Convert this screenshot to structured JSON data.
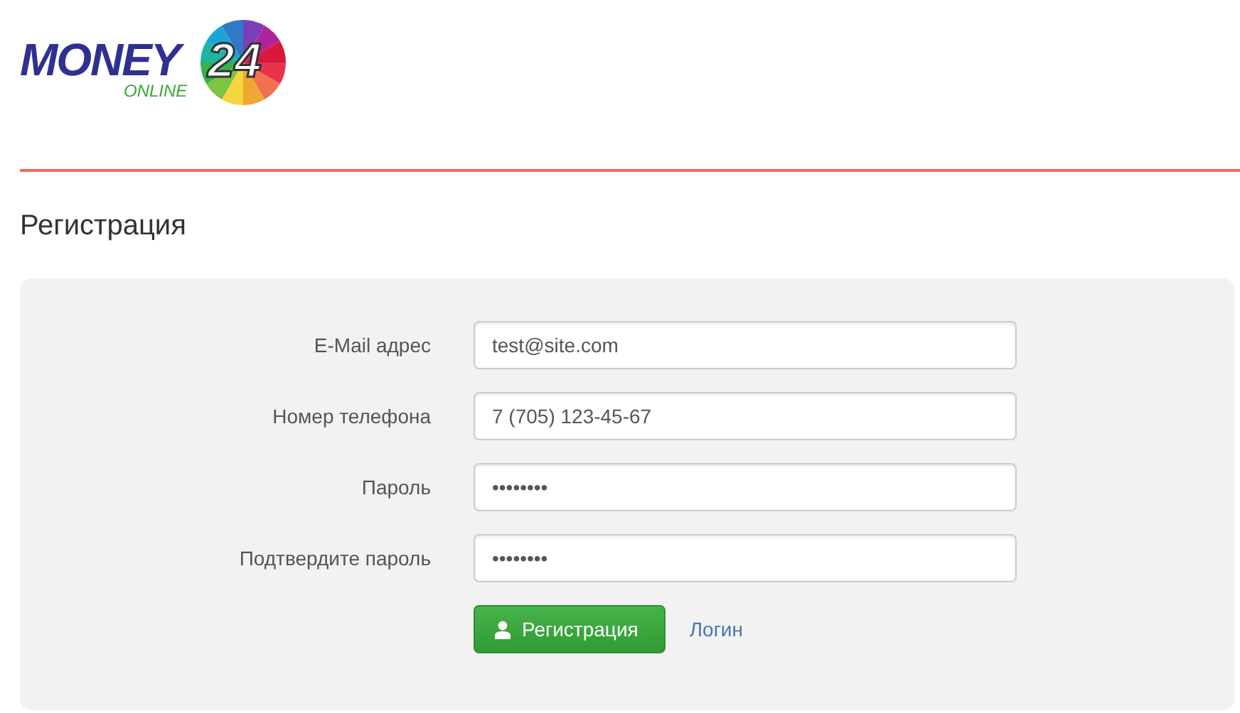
{
  "logo": {
    "word": "MONEY",
    "number": "24",
    "tagline": "ONLINE"
  },
  "title": "Регистрация",
  "fields": [
    {
      "label": "E-Mail адрес",
      "value": "test@site.com"
    },
    {
      "label": "Номер телефона",
      "value": "7 (705) 123-45-67"
    },
    {
      "label": "Пароль",
      "value": "••••••••"
    },
    {
      "label": "Подтвердите пароль",
      "value": "••••••••"
    }
  ],
  "submit": "Регистрация",
  "link": "Логин"
}
